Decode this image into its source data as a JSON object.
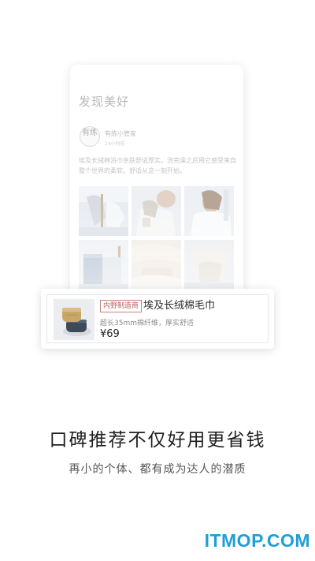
{
  "feed": {
    "title": "发现美好",
    "avatar_text": "有练",
    "author": "有练小管家",
    "time": "24小时前",
    "body": "埃及长绒棉浴巾亲肤舒适厚实。洗完澡之后用它感受来自整个世界的柔软。舒适从这一刻开始。"
  },
  "product": {
    "badge": "内野制造商",
    "name": "埃及长绒棉毛巾",
    "desc": "超长35mm棉纤维，厚实舒适",
    "price": "¥69"
  },
  "headline": "口碑推荐不仅好用更省钱",
  "subline": "再小的个体、都有成为达人的潜质",
  "watermark": "ITMOP.COM",
  "colors": {
    "accent": "#b8625d",
    "watermark": "#1e9fd6",
    "text": "#1f1f1f"
  }
}
